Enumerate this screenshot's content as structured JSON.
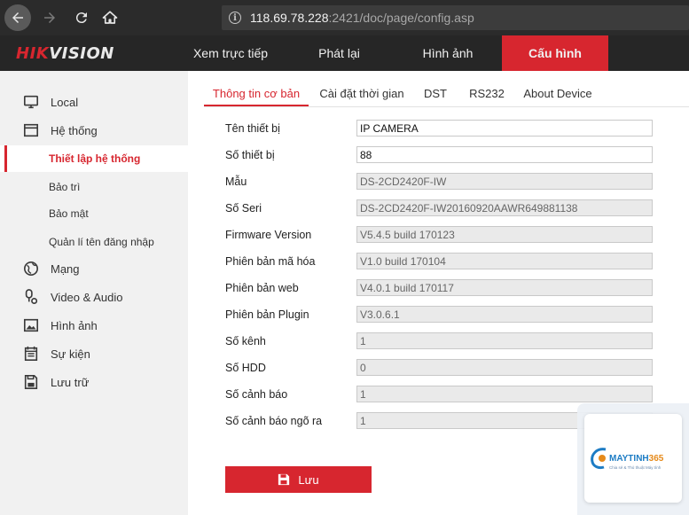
{
  "browser": {
    "url_host": "118.69.78.228",
    "url_path": ":2421/doc/page/config.asp"
  },
  "header": {
    "logo_hik": "HIK",
    "logo_vision": "VISION",
    "menu": [
      {
        "label": "Xem trực tiếp"
      },
      {
        "label": "Phát lại"
      },
      {
        "label": "Hình ảnh"
      },
      {
        "label": "Cấu hình"
      }
    ]
  },
  "sidebar": {
    "items": [
      {
        "label": "Local",
        "icon": "monitor-icon"
      },
      {
        "label": "Hệ thống",
        "icon": "window-icon"
      },
      {
        "label": "Thiết lập hệ thống"
      },
      {
        "label": "Bảo trì"
      },
      {
        "label": "Bảo mật"
      },
      {
        "label": "Quản lí tên đăng nhập"
      },
      {
        "label": "Mạng",
        "icon": "globe-icon"
      },
      {
        "label": "Video & Audio",
        "icon": "mic-camera-icon"
      },
      {
        "label": "Hình ảnh",
        "icon": "image-icon"
      },
      {
        "label": "Sự kiện",
        "icon": "calendar-icon"
      },
      {
        "label": "Lưu trữ",
        "icon": "disk-icon"
      }
    ]
  },
  "tabs": [
    {
      "label": "Thông tin cơ bản"
    },
    {
      "label": "Cài đặt thời gian"
    },
    {
      "label": "DST"
    },
    {
      "label": "RS232"
    },
    {
      "label": "About Device"
    }
  ],
  "form": {
    "rows": [
      {
        "label": "Tên thiết bị",
        "value": "IP CAMERA"
      },
      {
        "label": "Số thiết bị",
        "value": "88"
      },
      {
        "label": "Mẫu",
        "value": "DS-2CD2420F-IW"
      },
      {
        "label": "Số Seri",
        "value": "DS-2CD2420F-IW20160920AAWR649881138"
      },
      {
        "label": "Firmware Version",
        "value": "V5.4.5 build 170123"
      },
      {
        "label": "Phiên bản mã hóa",
        "value": "V1.0 build 170104"
      },
      {
        "label": "Phiên bản web",
        "value": "V4.0.1 build 170117"
      },
      {
        "label": "Phiên bản Plugin",
        "value": "V3.0.6.1"
      },
      {
        "label": "Số kênh",
        "value": "1"
      },
      {
        "label": "Số HDD",
        "value": "0"
      },
      {
        "label": "Số cảnh báo",
        "value": "1"
      },
      {
        "label": "Số cảnh báo ngõ ra",
        "value": "1"
      }
    ],
    "save_label": "Lưu"
  },
  "watermark": {
    "brand_a": "MAYTINH",
    "brand_b": "365",
    "tagline": "Chia sẻ & Thủ thuật Máy tính"
  },
  "colors": {
    "accent": "#d7262f",
    "header_bg": "#262626",
    "sidebar_bg": "#f1f1f1"
  }
}
